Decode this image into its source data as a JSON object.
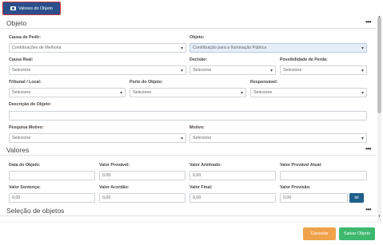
{
  "tab": {
    "label": "Valores do Objeto",
    "icon": "camera-icon"
  },
  "objeto": {
    "title": "Objeto",
    "menu_icon": "•••",
    "causa_pedir": {
      "label": "Causa de Pedir:",
      "value": "Contribuições de Melhoria"
    },
    "objeto": {
      "label": "Objeto:",
      "value": "Contribuição para a Iluminação Pública"
    },
    "causa_real": {
      "label": "Causa Real:",
      "value": "Selecione"
    },
    "decisao": {
      "label": "Decisão:",
      "value": "Selecione"
    },
    "possibilidade_perda": {
      "label": "Possibilidade de Perda:",
      "value": "Selecione"
    },
    "tribunal_local": {
      "label": "Tribunal / Local:",
      "value": "Selecione"
    },
    "porte_objeto": {
      "label": "Porte do Objeto:",
      "value": "Selecione"
    },
    "responsavel": {
      "label": "Responsável:",
      "value": "Selecione"
    },
    "descricao": {
      "label": "Descrição do Objeto:",
      "value": ""
    },
    "pesquisa_motivo": {
      "label": "Pesquisa Motivo:",
      "value": "Selecione"
    },
    "motivo": {
      "label": "Motivo:",
      "value": "Selecione"
    }
  },
  "valores": {
    "title": "Valores",
    "menu_icon": "•••",
    "data_objeto": {
      "label": "Data do Objeto:",
      "value": ""
    },
    "valor_provavel": {
      "label": "Valor Provável:",
      "value": "0,00"
    },
    "valor_arbitrado": {
      "label": "Valor Arbitrado:",
      "value": "0,00"
    },
    "valor_provavel_atual": {
      "label": "Valor Provável Atual:",
      "value": ""
    },
    "valor_sentenca": {
      "label": "Valor Sentença:",
      "value": "0,00"
    },
    "valor_acordao": {
      "label": "Valor Acordão:",
      "value": "0,00"
    },
    "valor_final": {
      "label": "Valor Final:",
      "value": "0,00"
    },
    "valor_provisao": {
      "label": "Valor Provisão:",
      "value": "0,00"
    },
    "calc_button": "lel"
  },
  "selecao": {
    "title": "Seleção de objetos",
    "menu_icon": "•••"
  },
  "footer": {
    "cancel_label": "Cancelar",
    "save_label": "Salvar Objeto"
  },
  "colors": {
    "accent": "#2c4f8c",
    "cancel": "#f0a24a",
    "save": "#3db86d",
    "calc": "#1f5f8b"
  }
}
